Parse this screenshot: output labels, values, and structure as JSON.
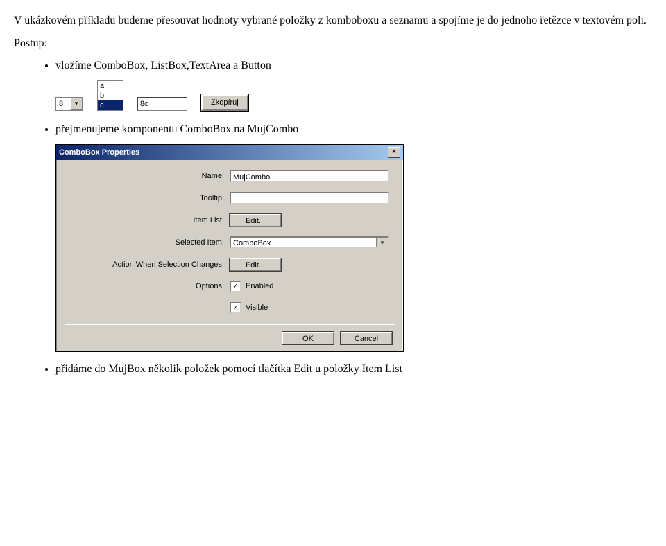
{
  "intro": "V ukázkovém příkladu budeme přesouvat hodnoty vybrané položky z komboboxu a seznamu a spojíme je do jednoho řetězce v textovém poli.",
  "postup": "Postup:",
  "bullet1": "vložíme ComboBox,  ListBox,TextArea a Button",
  "example": {
    "combo_value": "8",
    "list": {
      "a": "a",
      "b": "b",
      "c": "c"
    },
    "text_value": "8c",
    "button": "Zkopíruj"
  },
  "bullet2": "přejmenujeme komponentu ComboBox na MujCombo",
  "dialog": {
    "title": "ComboBox Properties",
    "close": "×",
    "name_lbl": "Name:",
    "name_val": "MujCombo",
    "tooltip_lbl": "Tooltip:",
    "tooltip_val": "",
    "itemlist_lbl": "Item List:",
    "edit1": "Edit...",
    "selitem_lbl": "Selected Item:",
    "selitem_val": "ComboBox",
    "action_lbl": "Action When Selection Changes:",
    "edit2": "Edit...",
    "options_lbl": "Options:",
    "enabled": "Enabled",
    "visible": "Visible",
    "ok": "OK",
    "cancel": "Cancel",
    "check": "✓"
  },
  "bullet3": "přidáme do MujBox několik položek pomocí tlačítka Edit u položky Item List"
}
